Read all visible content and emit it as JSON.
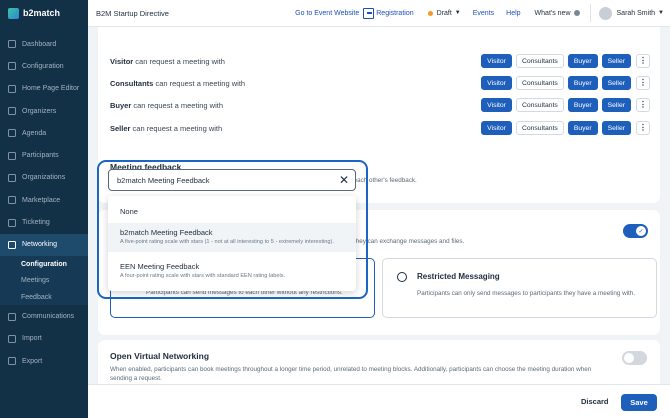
{
  "topbar": {
    "brand": "b2match",
    "event_name": "B2M Startup Directive",
    "goto_event": "Go to Event Website",
    "registration": "Registration",
    "draft": "Draft",
    "events": "Events",
    "help": "Help",
    "whats_new": "What's new",
    "user_name": "Sarah Smith"
  },
  "sidebar": {
    "items": [
      {
        "label": "Dashboard"
      },
      {
        "label": "Configuration"
      },
      {
        "label": "Home Page Editor"
      },
      {
        "label": "Organizers"
      },
      {
        "label": "Agenda"
      },
      {
        "label": "Participants"
      },
      {
        "label": "Organizations"
      },
      {
        "label": "Marketplace"
      },
      {
        "label": "Ticketing"
      },
      {
        "label": "Networking"
      },
      {
        "label": "Communications"
      },
      {
        "label": "Import"
      },
      {
        "label": "Export"
      }
    ],
    "networking_sub": [
      {
        "label": "Configuration"
      },
      {
        "label": "Meetings"
      },
      {
        "label": "Feedback"
      }
    ]
  },
  "permissions": {
    "suffix": "can request a meeting with",
    "rows": [
      {
        "role": "Visitor"
      },
      {
        "role": "Consultants"
      },
      {
        "role": "Buyer"
      },
      {
        "role": "Seller"
      }
    ],
    "buttons": [
      "Visitor",
      "Consultants",
      "Buyer",
      "Seller"
    ],
    "active_color": "#1e5fbb"
  },
  "meeting_feedback": {
    "title": "Meeting feedback",
    "description": "Participants can rate and leave comments after their meetings. Participants cannot see each other's feedback."
  },
  "dropdown": {
    "value": "b2match Meeting Feedback",
    "options": [
      {
        "title": "None",
        "desc": ""
      },
      {
        "title": "b2match Meeting Feedback",
        "desc": "A five-point rating scale with stars (1 - not at all interesting to 5 - extremely interesting)."
      },
      {
        "title": "EEN Meeting Feedback",
        "desc": "A four-point rating scale with stars with standard EEN rating labels."
      }
    ]
  },
  "messaging": {
    "desc_partial": "they can exchange messages and files.",
    "open_desc": "Participants can send messages to each other without any restrictions.",
    "restricted_title": "Restricted Messaging",
    "restricted_desc": "Participants can only send messages to participants they have a meeting with."
  },
  "virtual_networking": {
    "title": "Open Virtual Networking",
    "description": "When enabled, participants can book meetings throughout a longer time period, unrelated to meeting blocks. Additionally, participants can choose the meeting duration when sending a request."
  },
  "footer": {
    "discard": "Discard",
    "save": "Save"
  }
}
